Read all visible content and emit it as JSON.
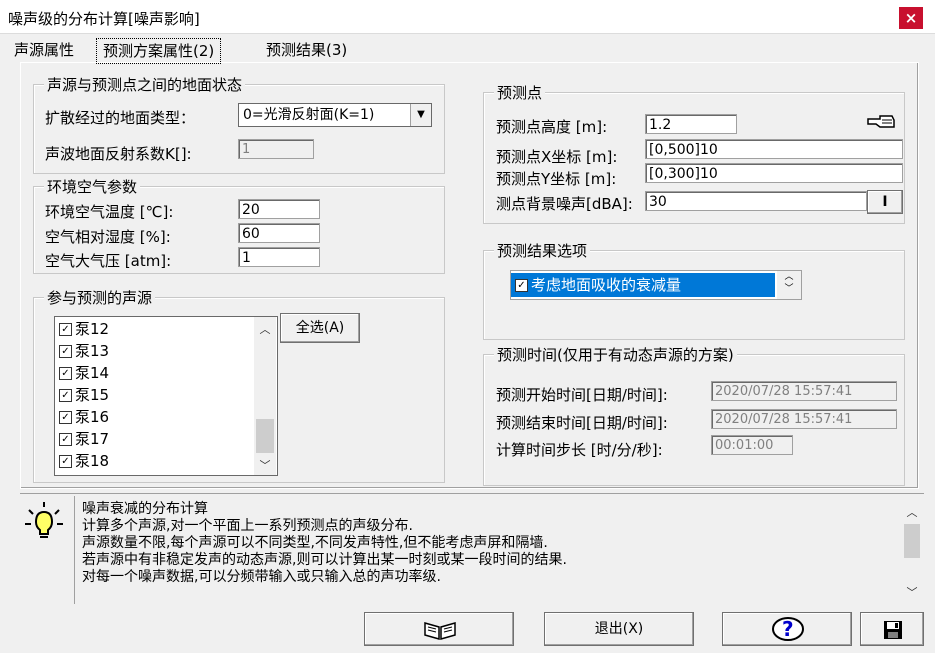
{
  "window": {
    "title": "噪声级的分布计算[噪声影响]",
    "close_glyph": "×"
  },
  "tabs": [
    {
      "label": "声源属性"
    },
    {
      "label": "预测方案属性(2)"
    },
    {
      "label": "预测结果(3)"
    }
  ],
  "ground": {
    "legend": "声源与预测点之间的地面状态",
    "type_label": "扩散经过的地面类型：",
    "type_value": "0=光滑反射面(K=1)",
    "coef_label": "声波地面反射系数K[]:",
    "coef_value": "1"
  },
  "air": {
    "legend": "环境空气参数",
    "temp_label": "环境空气温度 [℃]:",
    "temp_value": "20",
    "humidity_label": "空气相对湿度 [%]:",
    "humidity_value": "60",
    "pressure_label": "空气大气压  [atm]:",
    "pressure_value": "1"
  },
  "sources": {
    "legend": "参与预测的声源",
    "select_all_label": "全选(A)",
    "items": [
      "泵12",
      "泵13",
      "泵14",
      "泵15",
      "泵16",
      "泵17",
      "泵18"
    ],
    "check_glyph": "✓"
  },
  "predict_point": {
    "legend": "预测点",
    "height_label": "预测点高度 [m]:",
    "height_value": "1.2",
    "x_label": "预测点X坐标 [m]:",
    "x_value": "[0,500]10",
    "y_label": "预测点Y坐标 [m]:",
    "y_value": "[0,300]10",
    "bg_label": "测点背景噪声[dBA]:",
    "bg_value": "30",
    "bg_button_label": "I"
  },
  "result_options": {
    "legend": "预测结果选项",
    "option_label": "考虑地面吸收的衰减量"
  },
  "time": {
    "legend": "预测时间(仅用于有动态声源的方案)",
    "start_label": "预测开始时间[日期/时间]:",
    "start_value": "2020/07/28 15:57:41",
    "end_label": "预测结束时间[日期/时间]:",
    "end_value": "2020/07/28 15:57:41",
    "step_label": "计算时间步长 [时/分/秒]:",
    "step_value": "00:01:00"
  },
  "info": {
    "lines": [
      "噪声衰减的分布计算",
      "计算多个声源,对一个平面上一系列预测点的声级分布.",
      "声源数量不限,每个声源可以不同类型,不同发声特性,但不能考虑声屏和隔墙.",
      "若声源中有非稳定发声的动态声源,则可以计算出某一时刻或某一段时间的结果.",
      "对每一个噪声数据,可以分频带输入或只输入总的声功率级."
    ]
  },
  "bottom": {
    "exit_label": "退出(X)",
    "help_glyph": "?"
  },
  "colors": {
    "selection": "#0078d7",
    "close": "#c8102e"
  }
}
